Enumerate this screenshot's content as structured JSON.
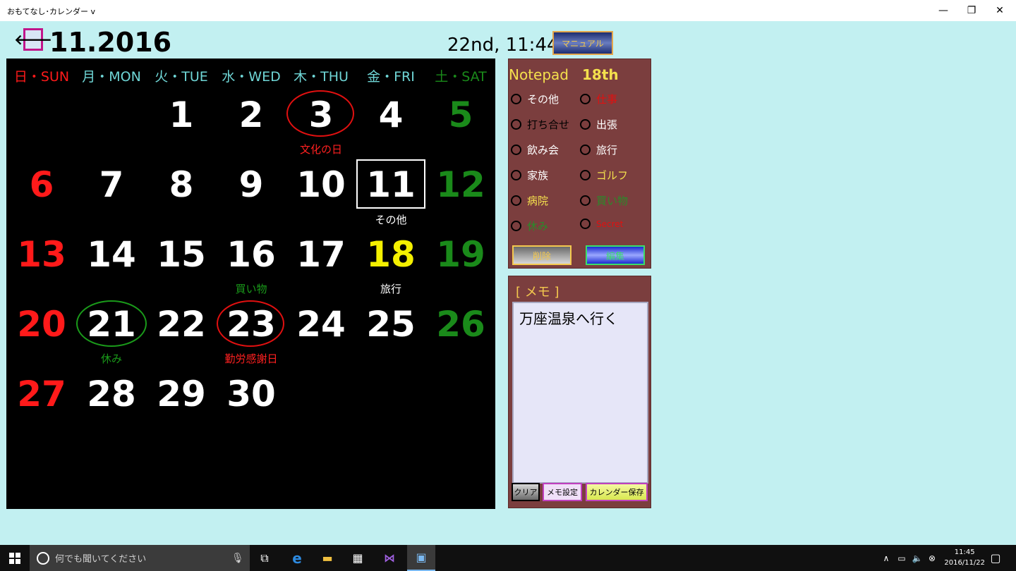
{
  "window": {
    "title": "おもてなし･カレンダー v",
    "minimize": "—",
    "restore": "❐",
    "close": "✕"
  },
  "header": {
    "back_icon": "🡐",
    "month_label": "11.2016",
    "datetime": "22nd, 11:44",
    "manual_label": "マニュアル"
  },
  "weekdays": [
    "日・SUN",
    "月・MON",
    "火・TUE",
    "水・WED",
    "木・THU",
    "金・FRI",
    "土・SAT"
  ],
  "colors": {
    "sunday": "#ff1a1a",
    "weekday_header": "#6fd6d6",
    "saturday": "#1a8a1a",
    "selected": "#f4f000",
    "holiday_ring": "#e01010",
    "rest_ring": "#1a9a1a"
  },
  "days": [
    "1",
    "2",
    "3",
    "4",
    "5",
    "6",
    "7",
    "8",
    "9",
    "10",
    "11",
    "12",
    "13",
    "14",
    "15",
    "16",
    "17",
    "18",
    "19",
    "20",
    "21",
    "22",
    "23",
    "24",
    "25",
    "26",
    "27",
    "28",
    "29",
    "30"
  ],
  "events": {
    "3": "文化の日",
    "11": "その他",
    "16": "買い物",
    "18": "旅行",
    "21": "休み",
    "23": "勤労感謝日"
  },
  "notepad": {
    "title": "Notepad",
    "date": "18th",
    "options": [
      "その他",
      "仕事",
      "打ち合せ",
      "出張",
      "飲み会",
      "旅行",
      "家族",
      "ゴルフ",
      "病院",
      "買い物",
      "休み",
      "Secret"
    ],
    "delete_label": "削除",
    "edit_label": "編集"
  },
  "memo": {
    "title": "[ メモ ]",
    "text": "万座温泉へ行く",
    "clear_label": "クリア",
    "settings_label": "メモ設定",
    "save_label": "カレンダー保存"
  },
  "taskbar": {
    "search_placeholder": "何でも聞いてください",
    "time": "11:45",
    "date": "2016/11/22"
  }
}
